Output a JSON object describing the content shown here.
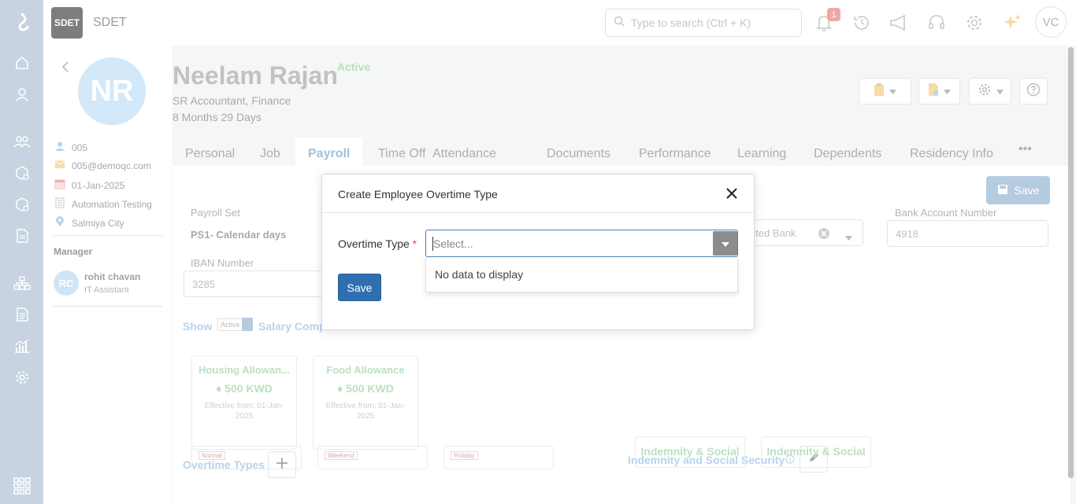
{
  "app": {
    "badge": "SDET",
    "name": "SDET"
  },
  "search": {
    "placeholder": "Type to search (Ctrl + K)"
  },
  "topbar": {
    "notification_count": "1",
    "user_initials": "VC"
  },
  "rail": {
    "icons": [
      "logo-icon",
      "home-icon",
      "person-icon",
      "people-icon",
      "box-settings-icon",
      "box-gear-icon",
      "document-icon",
      "org-chart-icon",
      "report-icon",
      "analytics-icon",
      "settings-icon",
      "apps-grid-icon"
    ]
  },
  "employee": {
    "initials": "NR",
    "name": "Neelam Rajan",
    "status": "Active",
    "title": "SR Accountant, Finance",
    "tenure": "8 Months 29 Days",
    "id": "005",
    "email": "005@demoqc.com",
    "join_date": "01-Jan-2025",
    "department": "Automation Testing",
    "location": "Salmiya City"
  },
  "manager": {
    "label": "Manager",
    "initials": "RC",
    "name": "rohit chavan",
    "role": "IT Assistant"
  },
  "tabs": [
    "Personal",
    "Job",
    "Payroll",
    "Time Off",
    "Attendance",
    "Documents",
    "Performance",
    "Learning",
    "Dependents",
    "Residency Info"
  ],
  "payroll": {
    "save_label": "Save",
    "payroll_set_label": "Payroll Set",
    "payroll_set_value": "PS1- Calendar days",
    "bank_value": "nited Bank",
    "bank_account_label": "Bank Account Number",
    "bank_account_value": "4918",
    "iban_label": "IBAN Number",
    "iban_value": "3285",
    "show_label": "Show",
    "active_tag": "Active",
    "salary_comp_label": "Salary Comp",
    "cards": [
      {
        "title": "Housing Allowan...",
        "amount": "500 KWD",
        "effective": "Effective from: 01-Jan-2025"
      },
      {
        "title": "Food Allowance",
        "amount": "500 KWD",
        "effective": "Effective from: 01-Jan-2025"
      }
    ],
    "overtime_types_label": "Overtime Types",
    "overtime_tags": [
      "Normal",
      "Weekend",
      "Holiday"
    ],
    "indemnity_label": "Indemnity and Social Security",
    "indemnity_cards": [
      "Indemnity & Social",
      "Indemnity & Social"
    ]
  },
  "modal": {
    "title": "Create Employee Overtime Type",
    "field_label": "Overtime Type",
    "required_mark": "*",
    "select_placeholder": "Select...",
    "no_data": "No data to display",
    "save_label": "Save"
  }
}
